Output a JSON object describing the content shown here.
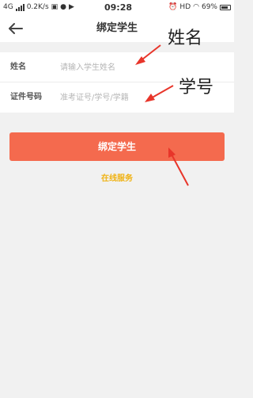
{
  "status_bar": {
    "network": "4G",
    "speed": "0.2K/s",
    "time": "09:28",
    "hd": "HD",
    "battery": "69%"
  },
  "header": {
    "title": "绑定学生"
  },
  "form": {
    "name_label": "姓名",
    "name_placeholder": "请输入学生姓名",
    "id_label": "证件号码",
    "id_placeholder": "准考证号/学号/学籍"
  },
  "actions": {
    "bind_label": "绑定学生",
    "online_service": "在线服务"
  },
  "annotations": {
    "name_note": "姓名",
    "id_note": "学号",
    "arrow_color": "#e8352a"
  },
  "colors": {
    "accent": "#f46a4e",
    "link": "#f0b316"
  }
}
